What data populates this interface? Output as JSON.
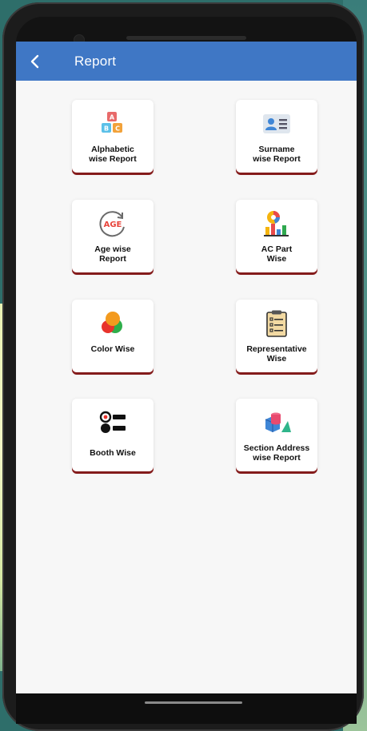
{
  "header": {
    "title": "Report"
  },
  "cards": [
    {
      "label": "Alphabetic\nwise Report",
      "icon": "abc-blocks-icon"
    },
    {
      "label": "Surname\nwise Report",
      "icon": "id-card-icon"
    },
    {
      "label": "Age wise\nReport",
      "icon": "age-icon"
    },
    {
      "label": "AC Part\nWise",
      "icon": "chart-person-icon"
    },
    {
      "label": "Color Wise",
      "icon": "color-circles-icon"
    },
    {
      "label": "Representative\nWise",
      "icon": "clipboard-list-icon"
    },
    {
      "label": "Booth Wise",
      "icon": "target-list-icon"
    },
    {
      "label": "Section Address\nwise Report",
      "icon": "shapes-icon"
    }
  ],
  "colors": {
    "appbar": "#3f77c5",
    "card_accent": "#8b1d1d",
    "background": "#f7f7f7"
  }
}
